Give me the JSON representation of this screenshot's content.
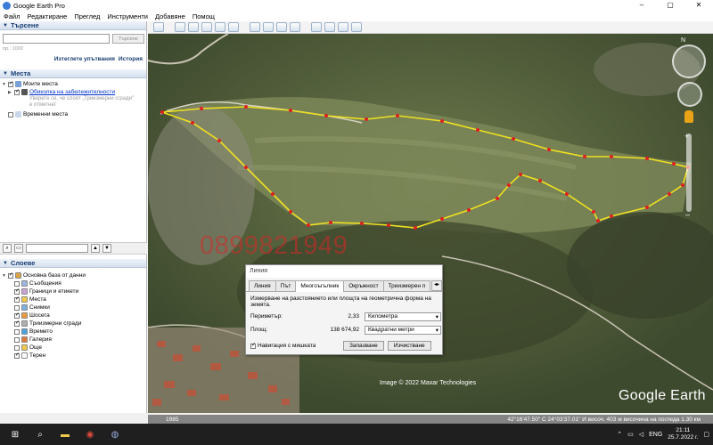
{
  "window": {
    "title": "Google Earth Pro",
    "controls": [
      "–",
      "▢",
      "✕"
    ]
  },
  "menu": [
    "Файл",
    "Редактиране",
    "Преглед",
    "Инструменти",
    "Добавяне",
    "Помощ"
  ],
  "search": {
    "header": "Търсене",
    "placeholder": "",
    "button": "Търсене",
    "hint": "пр.: 1000",
    "link_directions": "Изтеглете упътвания",
    "link_history": "История"
  },
  "places": {
    "header": "Места",
    "my_places": "Моите места",
    "tour_label": "Обиколка на забележителности",
    "tour_hint": "Уверете се, че слоят „Триизмерни сгради\" е отметнат",
    "temporary": "Временни места"
  },
  "layers": {
    "header": "Слоеве",
    "items": [
      {
        "label": "Основна база от данни",
        "checked": true,
        "color": "#d9a441"
      },
      {
        "label": "Съобщения",
        "checked": false,
        "color": "#9bb8e0"
      },
      {
        "label": "Граници и етикети",
        "checked": true,
        "color": "#c9a3d6"
      },
      {
        "label": "Места",
        "checked": true,
        "color": "#f2c94c"
      },
      {
        "label": "Снимки",
        "checked": false,
        "color": "#7fb0e0"
      },
      {
        "label": "Шосета",
        "checked": true,
        "color": "#f29a3c"
      },
      {
        "label": "Триизмерни сгради",
        "checked": true,
        "color": "#b0b0b0"
      },
      {
        "label": "Времето",
        "checked": false,
        "color": "#4aa3df"
      },
      {
        "label": "Галерия",
        "checked": false,
        "color": "#e07b39"
      },
      {
        "label": "Още",
        "checked": false,
        "color": "#f2c94c"
      },
      {
        "label": "Терен",
        "checked": true,
        "color": "#ffffff"
      }
    ]
  },
  "map": {
    "watermark_phone": "0899821949",
    "credit": "Image © 2022 Maxar Technologies",
    "logo": "Google Earth",
    "year": "1985",
    "status": "42°16'47.50\" С 24°03'37.01\" И  височ.  403 м          височина на погледа   1.30 км"
  },
  "ruler": {
    "title": "Линия",
    "tabs": [
      "Линия",
      "Път",
      "Многоъгълник",
      "Окръжност",
      "Триизмерен п"
    ],
    "active_tab": "Многоъгълник",
    "description": "Измерване на разстоянието или площта на геометрична форма на земята.",
    "perimeter_label": "Периметър:",
    "perimeter_value": "2,33",
    "perimeter_unit": "Километра",
    "area_label": "Площ:",
    "area_value": "138 674,92",
    "area_unit": "Квадратни метри",
    "mouse_nav": "Навигация с мишката",
    "save": "Запазване",
    "clear": "Изчистване"
  },
  "taskbar": {
    "lang": "ENG",
    "time": "21:11",
    "date": "25.7.2022 г."
  },
  "colors": {
    "polygon": "#f0e020",
    "vertex": "#e02020",
    "accent": "#1a3f73"
  }
}
